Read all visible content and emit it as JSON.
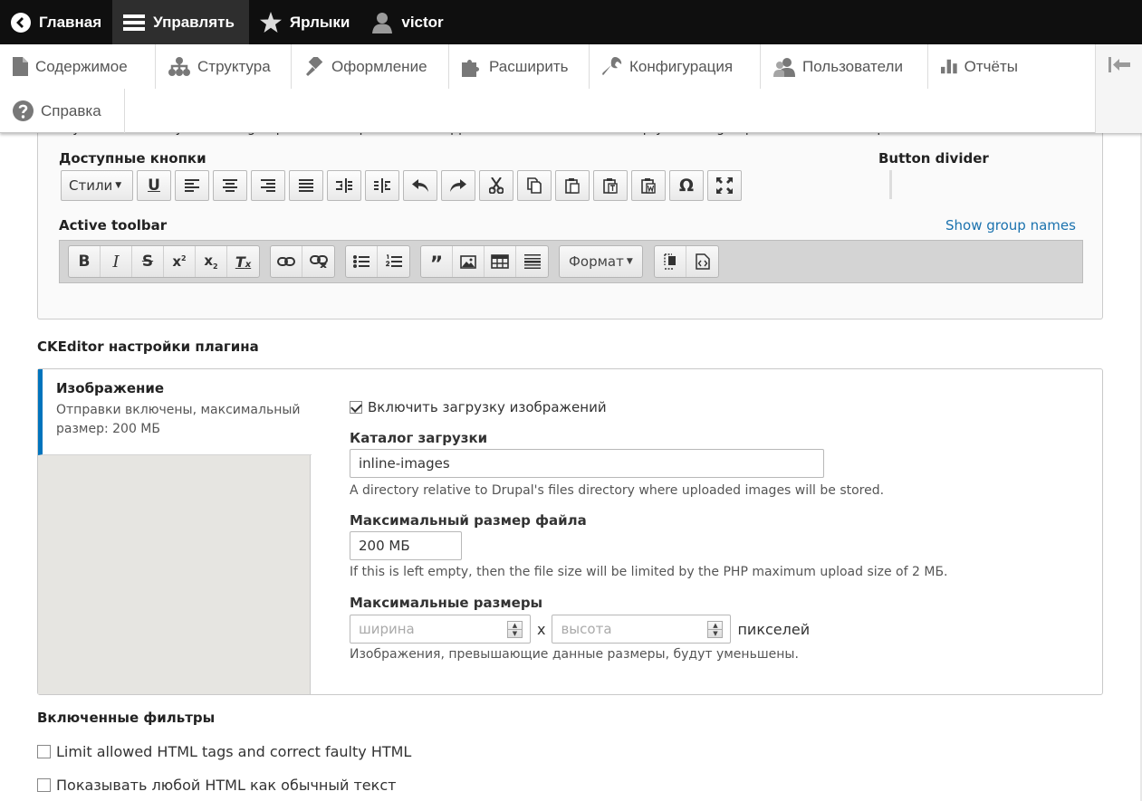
{
  "topbar": {
    "home": "Главная",
    "manage": "Управлять",
    "shortcuts": "Ярлыки",
    "user": "victor"
  },
  "tray": {
    "items": [
      {
        "label": "Содержимое",
        "icon": "file-icon"
      },
      {
        "label": "Структура",
        "icon": "sitemap-icon"
      },
      {
        "label": "Оформление",
        "icon": "paintbrush-icon"
      },
      {
        "label": "Расширить",
        "icon": "puzzle-icon"
      },
      {
        "label": "Конфигурация",
        "icon": "wrench-icon"
      },
      {
        "label": "Пользователи",
        "icon": "people-icon"
      },
      {
        "label": "Отчёты",
        "icon": "bar-chart-icon"
      }
    ],
    "help": "Справка"
  },
  "toolbar_config": {
    "cut_text": "keyboard arrow keys. Toolbar group names are provided to support screen reader users. Empty toolbar groups will be removed upon save.",
    "available_label": "Доступные кнопки",
    "styles_label": "Стили",
    "divider_label": "Button divider",
    "active_label": "Active toolbar",
    "show_groups": "Show group names",
    "format_label": "Формат"
  },
  "plugin_settings": {
    "title": "CKEditor настройки плагина",
    "tab_title": "Изображение",
    "tab_summary": "Отправки включены, максимальный размер: 200 МБ",
    "enable_uploads": "Включить загрузку изображений",
    "enable_checked": true,
    "dir_label": "Каталог загрузки",
    "dir_value": "inline-images",
    "dir_desc": "A directory relative to Drupal's files directory where uploaded images will be stored.",
    "size_label": "Максимальный размер файла",
    "size_value": "200 МБ",
    "size_desc": "If this is left empty, then the file size will be limited by the PHP maximum upload size of 2 МБ.",
    "dims_label": "Максимальные размеры",
    "width_placeholder": "ширина",
    "height_placeholder": "высота",
    "x_sep": "x",
    "px_unit": "пикселей",
    "dims_desc": "Изображения, превышающие данные размеры, будут уменьшены."
  },
  "filters": {
    "title": "Включенные фильтры",
    "items": [
      {
        "label": "Limit allowed HTML tags and correct faulty HTML",
        "checked": false
      },
      {
        "label": "Показывать любой HTML как обычный текст",
        "checked": false
      }
    ]
  },
  "colors": {
    "accent": "#0074bd",
    "link": "#1b72ae",
    "topbar_bg": "#0f0f0f"
  }
}
